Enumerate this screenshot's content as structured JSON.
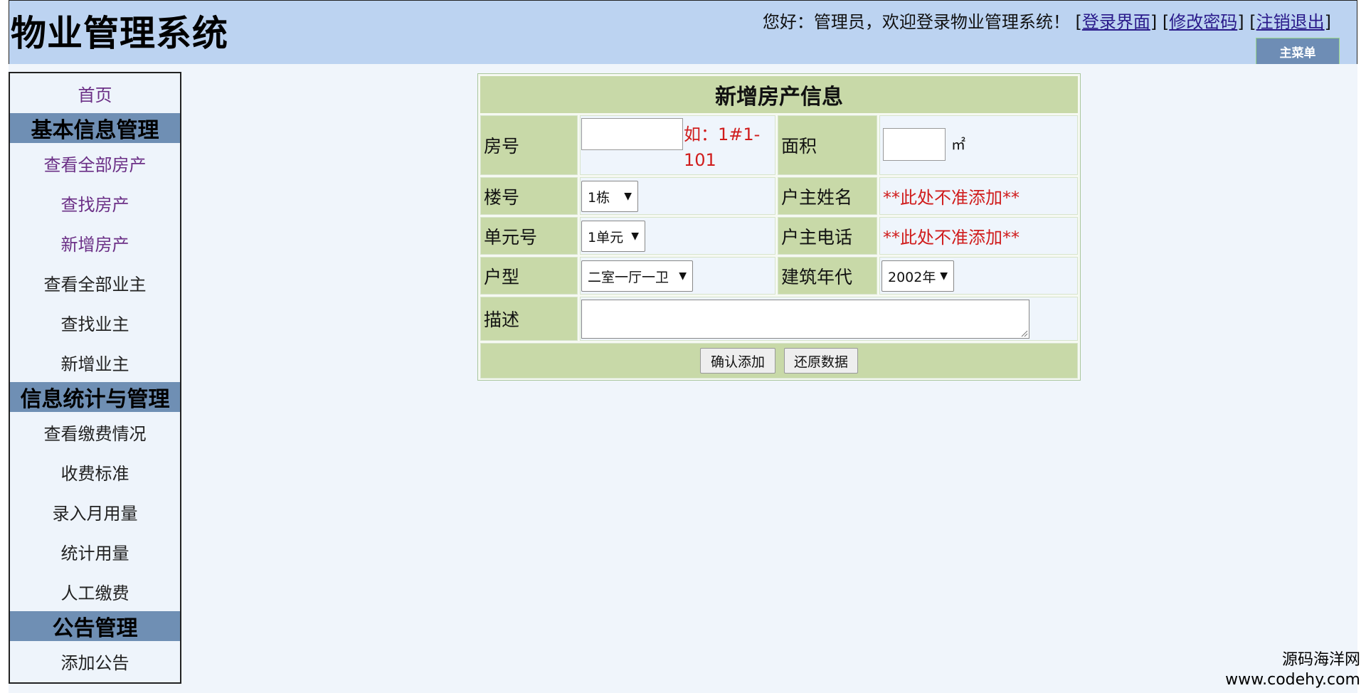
{
  "header": {
    "title": "物业管理系统",
    "greeting": "您好：管理员，欢迎登录物业管理系统！",
    "links": {
      "login": "登录界面",
      "change_password": "修改密码",
      "logout": "注销退出"
    },
    "main_menu": "主菜单"
  },
  "sidebar": {
    "home": "首页",
    "sections": [
      {
        "title": "基本信息管理",
        "items": [
          "查看全部房产",
          "查找房产",
          "新增房产",
          "查看全部业主",
          "查找业主",
          "新增业主"
        ]
      },
      {
        "title": "信息统计与管理",
        "items": [
          "查看缴费情况",
          "收费标准",
          "录入月用量",
          "统计用量",
          "人工缴费"
        ]
      },
      {
        "title": "公告管理",
        "items": [
          "添加公告"
        ]
      }
    ]
  },
  "form": {
    "title": "新增房产信息",
    "room_no": {
      "label": "房号",
      "value": "",
      "hint": "如：1#1-101"
    },
    "area": {
      "label": "面积",
      "value": "",
      "unit": "㎡"
    },
    "building": {
      "label": "楼号",
      "selected": "1栋"
    },
    "owner_name": {
      "label": "户主姓名",
      "note": "**此处不准添加**"
    },
    "unit_no": {
      "label": "单元号",
      "selected": "1单元"
    },
    "owner_phone": {
      "label": "户主电话",
      "note": "**此处不准添加**"
    },
    "layout": {
      "label": "户型",
      "selected": "二室一厅一卫"
    },
    "build_year": {
      "label": "建筑年代",
      "selected": "2002年"
    },
    "description": {
      "label": "描述",
      "value": ""
    },
    "buttons": {
      "confirm": "确认添加",
      "reset": "还原数据"
    }
  },
  "watermark": {
    "line1": "源码海洋网",
    "line2": "www.codehy.com"
  }
}
